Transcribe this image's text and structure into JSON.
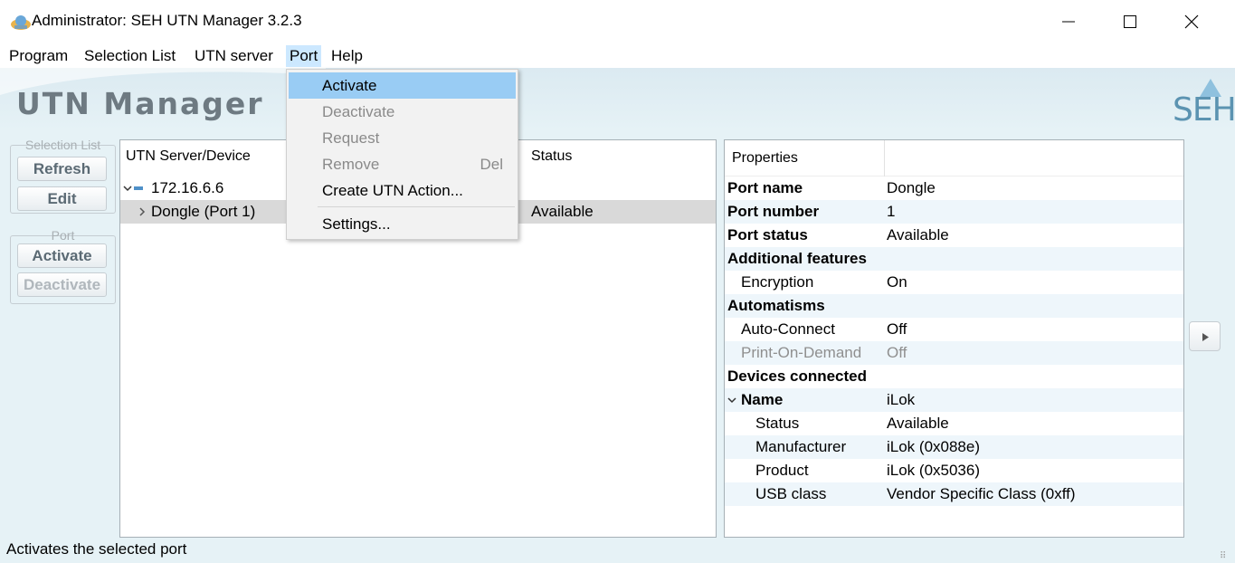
{
  "window": {
    "title": "Administrator: SEH UTN Manager 3.2.3",
    "icon": "app-globe-icon"
  },
  "menubar": {
    "items": [
      "Program",
      "Selection List",
      "UTN server",
      "Port",
      "Help"
    ],
    "open": "Port"
  },
  "port_menu": {
    "items": [
      {
        "label": "Activate",
        "enabled": true,
        "highlighted": true
      },
      {
        "label": "Deactivate",
        "enabled": false
      },
      {
        "label": "Request",
        "enabled": false
      },
      {
        "label": "Remove",
        "enabled": false,
        "shortcut": "Del"
      },
      {
        "label": "Create UTN Action...",
        "enabled": true
      },
      {
        "label": "Settings...",
        "enabled": true
      }
    ]
  },
  "banner": {
    "title": "UTN Manager",
    "logo": "SEH",
    "colors": {
      "logo": "#5b93b1",
      "title": "#6e7a82"
    }
  },
  "sidebar": {
    "selection_group": {
      "label": "Selection List",
      "buttons": [
        "Refresh",
        "Edit"
      ]
    },
    "port_group": {
      "label": "Port",
      "buttons": [
        "Activate",
        "Deactivate"
      ]
    }
  },
  "tree": {
    "headers": {
      "device": "UTN Server/Device",
      "status": "Status"
    },
    "rows": [
      {
        "label": "172.16.6.6",
        "status": "",
        "expanded": true
      },
      {
        "label": "Dongle (Port 1)",
        "status": "Available",
        "selected": true
      }
    ]
  },
  "properties": {
    "header": "Properties",
    "rows": [
      {
        "key": "Port name",
        "value": "Dongle"
      },
      {
        "key": "Port number",
        "value": "1"
      },
      {
        "key": "Port status",
        "value": "Available"
      },
      {
        "key": "Additional features",
        "value": ""
      },
      {
        "key": "Encryption",
        "value": "On"
      },
      {
        "key": "Automatisms",
        "value": ""
      },
      {
        "key": "Auto-Connect",
        "value": "Off"
      },
      {
        "key": "Print-On-Demand",
        "value": "Off"
      },
      {
        "key": "Devices connected",
        "value": ""
      },
      {
        "key": "Name",
        "value": "iLok"
      },
      {
        "key": "Status",
        "value": "Available"
      },
      {
        "key": "Manufacturer",
        "value": "iLok (0x088e)"
      },
      {
        "key": "Product",
        "value": "iLok (0x5036)"
      },
      {
        "key": "USB class",
        "value": "Vendor Specific Class (0xff)"
      }
    ]
  },
  "statusbar": {
    "text": "Activates the selected port"
  }
}
